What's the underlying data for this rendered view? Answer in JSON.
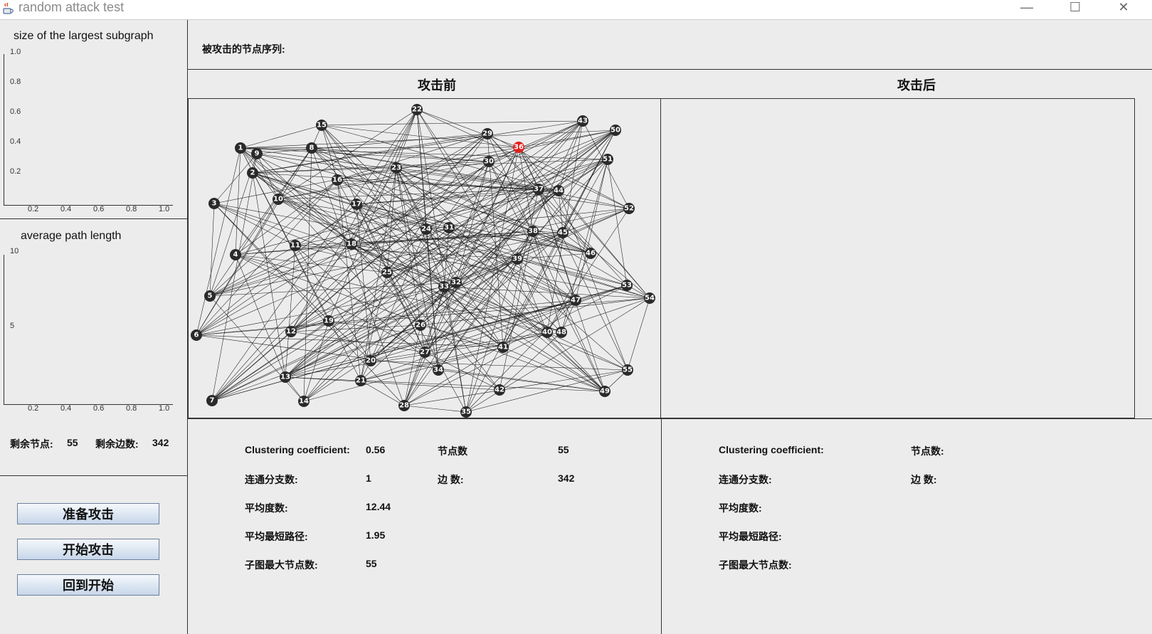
{
  "window": {
    "title": "random attack test",
    "minimize_glyph": "—",
    "maximize_glyph": "☐",
    "close_glyph": "✕",
    "icon": "java-coffee-icon"
  },
  "left": {
    "chart1": {
      "title": "size of the largest subgraph",
      "yticks": [
        "1.0",
        "0.8",
        "0.6",
        "0.4",
        "0.2"
      ],
      "xticks": [
        "0.2",
        "0.4",
        "0.6",
        "0.8",
        "1.0"
      ]
    },
    "chart2": {
      "title": "average path length",
      "yticks": [
        "10",
        "5"
      ],
      "xticks": [
        "0.2",
        "0.4",
        "0.6",
        "0.8",
        "1.0"
      ]
    },
    "remaining_nodes_label": "剩余节点:",
    "remaining_nodes_value": "55",
    "remaining_edges_label": "剩余边数:",
    "remaining_edges_value": "342",
    "buttons": {
      "prepare": "准备攻击",
      "start": "开始攻击",
      "reset": "回到开始"
    }
  },
  "attack_sequence_label": "被攻击的节点序列:",
  "before_title": "攻击前",
  "after_title": "攻击后",
  "before_stats": {
    "clustering_label": "Clustering coefficient:",
    "clustering_value": "0.56",
    "nodes_label": "节点数",
    "nodes_value": "55",
    "components_label": "连通分支数:",
    "components_value": "1",
    "edges_label": "边 数:",
    "edges_value": "342",
    "avg_degree_label": "平均度数:",
    "avg_degree_value": "12.44",
    "avg_path_label": "平均最短路径:",
    "avg_path_value": "1.95",
    "max_sub_label": "子图最大节点数:",
    "max_sub_value": "55"
  },
  "after_stats": {
    "clustering_label": "Clustering coefficient:",
    "nodes_label": "节点数:",
    "components_label": "连通分支数:",
    "edges_label": "边 数:",
    "avg_degree_label": "平均度数:",
    "avg_path_label": "平均最短路径:",
    "max_sub_label": "子图最大节点数:"
  },
  "graph": {
    "node_color": "#2a2a2a",
    "highlight_color": "#e02020",
    "highlighted": [
      36
    ],
    "nodes": [
      "1",
      "2",
      "3",
      "4",
      "5",
      "6",
      "7",
      "8",
      "9",
      "10",
      "11",
      "12",
      "13",
      "14",
      "15",
      "16",
      "17",
      "18",
      "19",
      "20",
      "21",
      "22",
      "23",
      "24",
      "25",
      "26",
      "27",
      "28",
      "29",
      "30",
      "31",
      "32",
      "33",
      "34",
      "35",
      "36",
      "37",
      "38",
      "39",
      "40",
      "41",
      "42",
      "43",
      "44",
      "45",
      "46",
      "47",
      "48",
      "49",
      "50",
      "51",
      "52",
      "53",
      "54",
      "55"
    ]
  }
}
